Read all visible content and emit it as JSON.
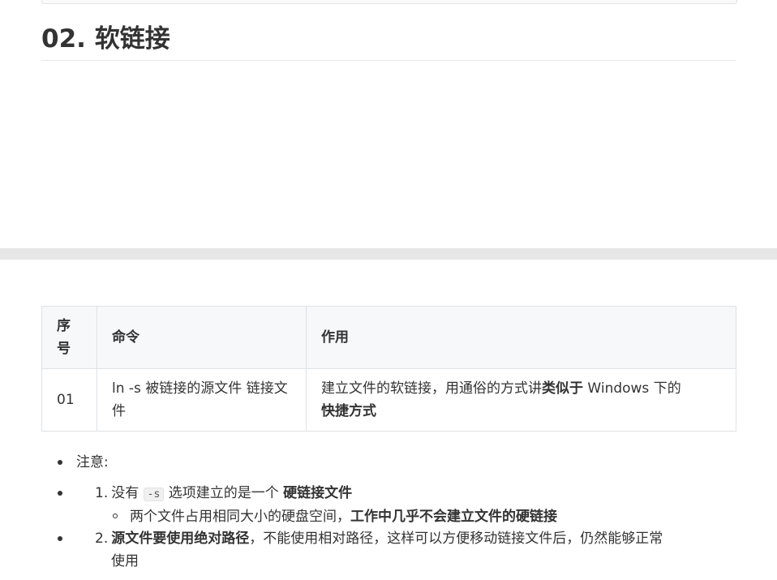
{
  "heading": "02. 软链接",
  "table": {
    "headers": [
      "序号",
      "命令",
      "作用"
    ],
    "rows": [
      {
        "seq": "01",
        "command": "ln -s 被链接的源文件 链接文件",
        "effect_prefix": "建立文件的软链接，用通俗的方式讲",
        "effect_bold_1": "类似于",
        "effect_middle": " Windows 下的",
        "effect_bold_2": "快捷方式"
      }
    ]
  },
  "notes": {
    "title": "注意:",
    "item1": {
      "number": "1.",
      "text_before": "没有",
      "code": "-s",
      "text_after": "选项建立的是一个",
      "bold": "硬链接文件",
      "sub_text": "两个文件占用相同大小的硬盘空间，",
      "sub_bold": "工作中几乎不会建立文件的硬链接"
    },
    "item2": {
      "number": "2.",
      "bold": "源文件要使用绝对路径",
      "text": "，不能使用相对路径，这样可以方便移动链接文件后，仍然能够正常",
      "continuation": "使用"
    }
  }
}
